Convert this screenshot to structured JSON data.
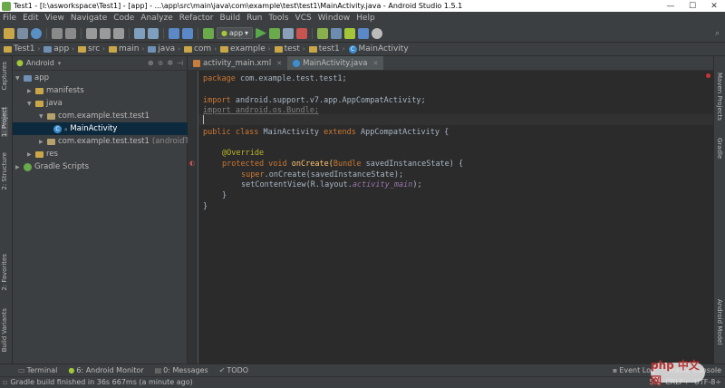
{
  "window": {
    "title": "Test1 - [I:\\asworkspace\\Test1] - [app] - ...\\app\\src\\main\\java\\com\\example\\test\\test1\\MainActivity.java - Android Studio 1.5.1",
    "controls": [
      "—",
      "☐",
      "✕"
    ]
  },
  "menu": [
    "File",
    "Edit",
    "View",
    "Navigate",
    "Code",
    "Analyze",
    "Refactor",
    "Build",
    "Run",
    "Tools",
    "VCS",
    "Window",
    "Help"
  ],
  "toolbar": {
    "run_config": "app",
    "icons": [
      "open-icon",
      "save-icon",
      "sync-icon",
      "undo-icon",
      "redo-icon",
      "cut-icon",
      "copy-icon",
      "paste-icon",
      "find-icon",
      "replace-icon",
      "back-icon",
      "forward-icon",
      "make-icon",
      "run-icon",
      "debug-icon",
      "attach-icon",
      "stop-icon",
      "avd-icon",
      "sdk-icon",
      "android-icon",
      "help-icon"
    ]
  },
  "breadcrumbs": [
    "Test1",
    "app",
    "src",
    "main",
    "java",
    "com",
    "example",
    "test",
    "test1",
    "MainActivity"
  ],
  "left_tabs": [
    "Captures",
    "1: Project",
    "2: Structure",
    "2: Favorites",
    "Build Variants"
  ],
  "right_tabs": [
    "Maven Projects",
    "Gradle",
    "Android Model"
  ],
  "project": {
    "view": "Android",
    "tree": [
      {
        "label": "app",
        "indent": 0,
        "expanded": true,
        "icon": "module"
      },
      {
        "label": "manifests",
        "indent": 1,
        "expanded": false,
        "icon": "folder"
      },
      {
        "label": "java",
        "indent": 1,
        "expanded": true,
        "icon": "folder"
      },
      {
        "label": "com.example.test.test1",
        "indent": 2,
        "expanded": true,
        "icon": "package"
      },
      {
        "label": "MainActivity",
        "indent": 3,
        "expanded": null,
        "icon": "class",
        "selected": true
      },
      {
        "label": "com.example.test.test1",
        "suffix": "(androidTest)",
        "indent": 2,
        "expanded": false,
        "icon": "package"
      },
      {
        "label": "res",
        "indent": 1,
        "expanded": false,
        "icon": "folder"
      },
      {
        "label": "Gradle Scripts",
        "indent": 0,
        "expanded": false,
        "icon": "gradle"
      }
    ]
  },
  "editor_tabs": [
    {
      "label": "activity_main.xml",
      "active": false
    },
    {
      "label": "MainActivity.java",
      "active": true
    }
  ],
  "code": {
    "l1": {
      "kw": "package",
      "rest": " com.example.test.test1;"
    },
    "l2": {
      "kw": "import",
      "rest": " android.support.v7.app.AppCompatActivity;"
    },
    "l3": {
      "text": "import android.os.Bundle;"
    },
    "l4": {
      "kw1": "public class",
      "name": " MainActivity ",
      "kw2": "extends",
      "rest": " AppCompatActivity {"
    },
    "l5": {
      "ann": "@Override"
    },
    "l6": {
      "kw": "protected void",
      "name": " onCreate(",
      "type": "Bundle",
      "rest": " savedInstanceState) {"
    },
    "l7": {
      "kw": "super",
      "rest": ".onCreate(savedInstanceState);"
    },
    "l8": {
      "pre": "setContentView(R.layout.",
      "it": "activity_main",
      "post": ");"
    },
    "l9": "}",
    "l10": "}"
  },
  "bottom_tabs": [
    "Terminal",
    "6: Android Monitor",
    "0: Messages",
    "TODO",
    "Event Log",
    "Gradle Console"
  ],
  "status": {
    "message": "Gradle build finished in 36s 667ms (a minute ago)",
    "position": "5:1",
    "line_sep": "CRLF÷",
    "encoding": "UTF-8÷"
  },
  "watermark": "php 中文网",
  "colors": {
    "keyword": "#cc7832",
    "annotation": "#bbb529",
    "field_italic": "#9876aa",
    "selection": "#0d293e"
  }
}
